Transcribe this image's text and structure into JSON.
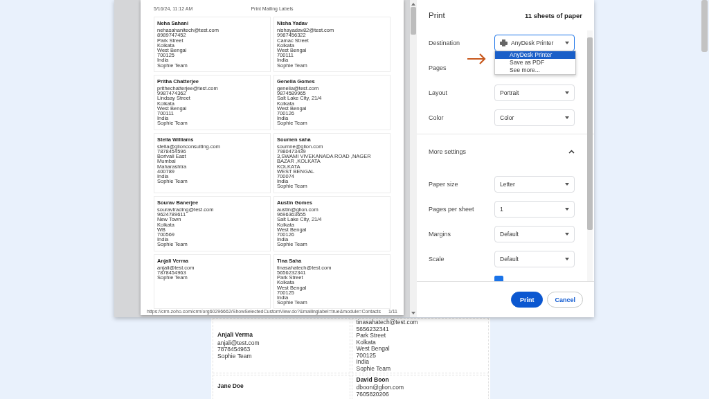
{
  "background_page": {
    "labels": [
      {
        "name": "Anjali Verma",
        "lines": [
          "anjali@test.com",
          "7878454963",
          "Sophie Team"
        ]
      },
      {
        "lines": [
          "tinasahatech@test.com",
          "5656232341",
          "Park Street",
          "Kolkata",
          "West Bengal",
          "700125",
          "India",
          "Sophie Team"
        ]
      },
      {
        "name": "Jane Doe"
      },
      {
        "name": "David Boon",
        "lines": [
          "dboon@glion.com",
          "7605820206"
        ]
      }
    ]
  },
  "preview": {
    "header_date": "5/16/24, 11:12 AM",
    "header_title": "Print Mailing Labels",
    "labels": [
      {
        "name": "Neha Sahani",
        "lines": [
          "nehasahanitech@test.com",
          "8989747452",
          "Park Street",
          "Kolkata",
          "West Bengal",
          "700125",
          "India",
          "Sophie Team"
        ]
      },
      {
        "name": "Nisha Yadav",
        "lines": [
          "nishayadav82@test.com",
          "9987456322",
          "Camac Street",
          "Kolkata",
          "West Bengal",
          "700111",
          "India",
          "Sophie Team"
        ]
      },
      {
        "name": "Pritha Chatterjee",
        "lines": [
          "prithechatterjee@test.com",
          "9987474362",
          "Lindsay Street",
          "Kolkata",
          "West Bengal",
          "700111",
          "India",
          "Sophie Team"
        ]
      },
      {
        "name": "Genelia Gomes",
        "lines": [
          "genelia@test.com",
          "9874589965",
          "Salt Lake City, 21/4",
          "Kolkata",
          "West Bengal",
          "700126",
          "India",
          "Sophie Team"
        ]
      },
      {
        "name": "Stella Williams",
        "lines": [
          "stella@glionconsulting.com",
          "7878454596",
          "Borivali East",
          "Mumbai",
          "Maharashtra",
          "400789",
          "India",
          "Sophie Team"
        ]
      },
      {
        "name": "Soumen saha",
        "lines": [
          "soumne@glion.com",
          "7980473439",
          "3,SWAMI VIVEKANADA ROAD ,NAGER",
          "BAZAR ,KOLKATA",
          "KOLKATA",
          "WEST BENGAL",
          "700074",
          "India",
          "Sophie Team"
        ]
      },
      {
        "name": "Sourav Banerjee",
        "lines": [
          "souravtrading@test.com",
          "9624789611",
          "New Town",
          "Kolkata",
          "WB",
          "700569",
          "India",
          "Sophie Team"
        ]
      },
      {
        "name": "Austin Gomes",
        "lines": [
          "austin@glion.com",
          "9696363655",
          "Salt Lake City, 21/4",
          "Kolkata",
          "West Bengal",
          "700126",
          "India",
          "Sophie Team"
        ]
      },
      {
        "name": "Anjali Verma",
        "lines": [
          "anjali@test.com",
          "7878454963",
          "Sophie Team"
        ]
      },
      {
        "name": "Tina Saha",
        "lines": [
          "tinasahatech@test.com",
          "5656232341",
          "Park Street",
          "Kolkata",
          "West Bengal",
          "700125",
          "India",
          "Sophie Team"
        ]
      }
    ],
    "footer_url": "https://crm.zoho.com/crm/org60296662/ShowSelectedCustomView.do?&mailinglabel=true&module=Contacts",
    "page_number": "1/11"
  },
  "print_panel": {
    "title": "Print",
    "sheets": "11 sheets of paper",
    "destination": {
      "label": "Destination",
      "value": "AnyDesk Printer"
    },
    "destination_options": [
      {
        "label": "AnyDesk Printer",
        "selected": true
      },
      {
        "label": "Save as PDF",
        "selected": false
      },
      {
        "label": "See more...",
        "selected": false
      }
    ],
    "pages": {
      "label": "Pages"
    },
    "settings": [
      {
        "label": "Layout",
        "value": "Portrait"
      },
      {
        "label": "Color",
        "value": "Color"
      }
    ],
    "more_settings": {
      "label": "More settings",
      "expanded": true
    },
    "more": [
      {
        "label": "Paper size",
        "value": "Letter"
      },
      {
        "label": "Pages per sheet",
        "value": "1"
      },
      {
        "label": "Margins",
        "value": "Default"
      },
      {
        "label": "Scale",
        "value": "Default"
      }
    ],
    "options_checkbox": {
      "checked": true
    },
    "buttons": [
      {
        "label": "Print",
        "kind": "primary"
      },
      {
        "label": "Cancel",
        "kind": "secondary"
      }
    ]
  }
}
